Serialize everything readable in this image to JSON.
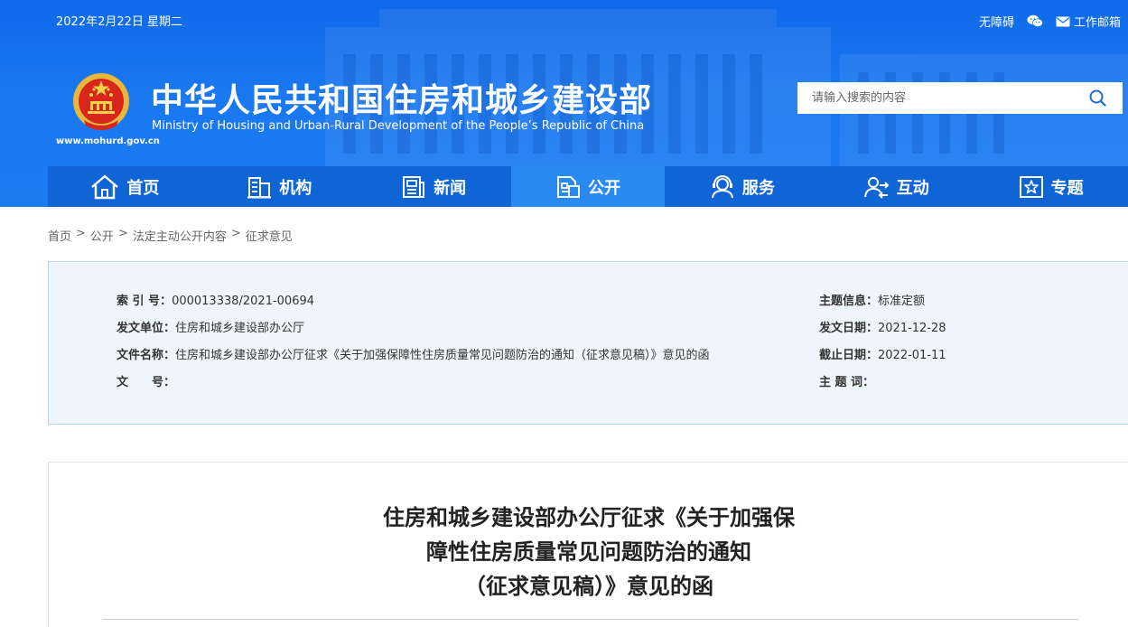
{
  "header": {
    "date": "2022年2月22日 星期二",
    "links": {
      "accessibility": "无障碍",
      "mail": "工作邮箱"
    },
    "title_cn": "中华人民共和国住房和城乡建设部",
    "title_en": "Ministry of Housing and Urban-Rural Development of the People’s Republic of China",
    "site_url": "www.mohurd.gov.cn",
    "search": {
      "placeholder": "请输入搜索的内容",
      "value": ""
    }
  },
  "nav": {
    "items": [
      {
        "label": "首页",
        "icon": "home-icon"
      },
      {
        "label": "机构",
        "icon": "building-icon"
      },
      {
        "label": "新闻",
        "icon": "news-icon"
      },
      {
        "label": "公开",
        "icon": "document-icon",
        "active": true
      },
      {
        "label": "服务",
        "icon": "service-icon"
      },
      {
        "label": "互动",
        "icon": "interaction-icon"
      },
      {
        "label": "专题",
        "icon": "star-icon"
      }
    ]
  },
  "breadcrumb": [
    "首页",
    "公开",
    "法定主动公开内容",
    "征求意见"
  ],
  "info": {
    "index_label": "索 引 号：",
    "index_value": "000013338/2021-00694",
    "issuer_label": "发文单位：",
    "issuer_value": "住房和城乡建设部办公厅",
    "filename_label": "文件名称：",
    "filename_value": "住房和城乡建设部办公厅征求《关于加强保障性住房质量常见问题防治的通知（征求意见稿）》意见的函",
    "docno_label": "文　　号：",
    "docno_value": "",
    "topic_label": "主题信息：",
    "topic_value": "标准定额",
    "date_label": "发文日期：",
    "date_value": "2021-12-28",
    "deadline_label": "截止日期：",
    "deadline_value": "2022-01-11",
    "keywords_label": "主 题 词：",
    "keywords_value": ""
  },
  "document": {
    "title_lines": [
      "住房和城乡建设部办公厅征求《关于加强保",
      "障性住房质量常见问题防治的通知",
      "（征求意见稿）》意见的函"
    ]
  },
  "colors": {
    "header_blue": "#1a78f0",
    "nav_blue": "#1065d6",
    "nav_active": "#2a8af4",
    "info_bg": "#eef5fc"
  }
}
